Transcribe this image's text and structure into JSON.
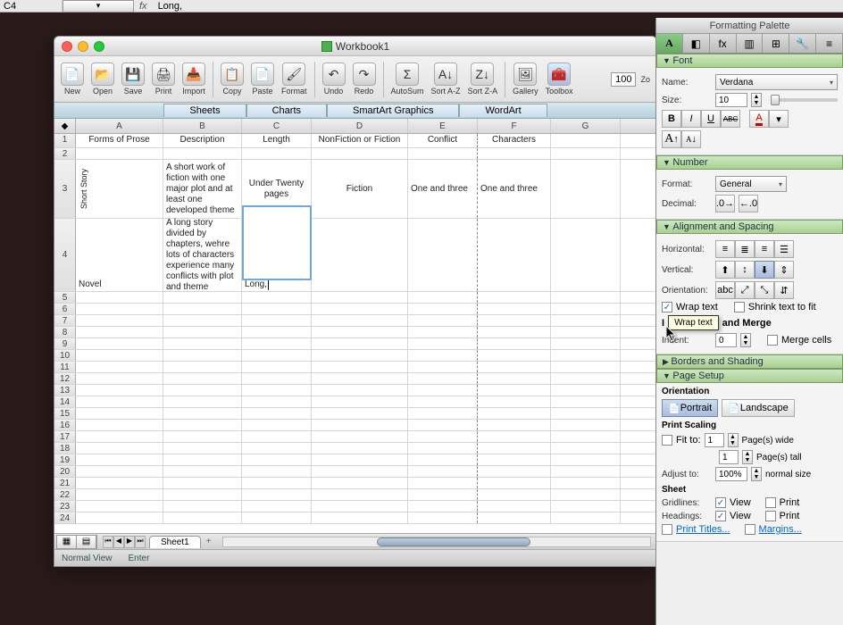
{
  "formula_bar": {
    "cell_ref": "C4",
    "fx_label": "fx",
    "value": "Long,"
  },
  "window": {
    "title": "Workbook1"
  },
  "toolbar": {
    "new": "New",
    "open": "Open",
    "save": "Save",
    "print": "Print",
    "import": "Import",
    "copy": "Copy",
    "paste": "Paste",
    "format": "Format",
    "undo": "Undo",
    "redo": "Redo",
    "autosum": "AutoSum",
    "sortaz": "Sort A-Z",
    "sortza": "Sort Z-A",
    "gallery": "Gallery",
    "toolbox": "Toolbox",
    "zoom": "Zo",
    "zoom_val": "100"
  },
  "viewtabs": {
    "sheets": "Sheets",
    "charts": "Charts",
    "smartart": "SmartArt Graphics",
    "wordart": "WordArt"
  },
  "columns": [
    "A",
    "B",
    "C",
    "D",
    "E",
    "F",
    "G"
  ],
  "headers_row": {
    "forms": "Forms of Prose",
    "desc": "Description",
    "length": "Length",
    "nf": "NonFiction or Fiction",
    "conflict": "Conflict",
    "chars": "Characters"
  },
  "rows": {
    "r3": {
      "a": "Short Story",
      "b": "A short work of fiction with one major plot and at least one developed theme",
      "c": "Under Twenty pages",
      "d": "Fiction",
      "e": "One and three",
      "f": "One and three"
    },
    "r4": {
      "a": "Novel",
      "b": "A long story divided by chapters, wehre lots of characters experience many conflicts with plot and theme",
      "c": "Long, "
    }
  },
  "row_numbers": [
    "1",
    "2",
    "3",
    "4",
    "5",
    "6",
    "7",
    "8",
    "9",
    "10",
    "11",
    "12",
    "13",
    "14",
    "15",
    "16",
    "17",
    "18",
    "19",
    "20",
    "21",
    "22",
    "23",
    "24"
  ],
  "bottom": {
    "sheet_tab": "Sheet1",
    "add": "+"
  },
  "status": {
    "view": "Normal View",
    "mode": "Enter"
  },
  "palette": {
    "title": "Formatting Palette",
    "font_hdr": "Font",
    "font": {
      "name_lbl": "Name:",
      "name_val": "Verdana",
      "size_lbl": "Size:",
      "size_val": "10",
      "b": "B",
      "i": "I",
      "u": "U",
      "s": "ABC",
      "aplus": "A",
      "aminus": "A"
    },
    "number_hdr": "Number",
    "number": {
      "format_lbl": "Format:",
      "format_val": "General",
      "dec_lbl": "Decimal:"
    },
    "align_hdr": "Alignment and Spacing",
    "align": {
      "h_lbl": "Horizontal:",
      "v_lbl": "Vertical:",
      "o_lbl": "Orientation:",
      "wrap": "Wrap text",
      "shrink": "Shrink text to fit",
      "indmerge": "and Merge",
      "ind_lbl": "Indent:",
      "ind_val": "0",
      "merge": "Merge cells",
      "tooltip": "Wrap text",
      "abc": "abc"
    },
    "borders_hdr": "Borders and Shading",
    "page_hdr": "Page Setup",
    "page": {
      "orient_lbl": "Orientation",
      "portrait": "Portrait",
      "landscape": "Landscape",
      "scale_lbl": "Print Scaling",
      "fit": "Fit to:",
      "fit_w": "1",
      "fit_h": "1",
      "pw": "Page(s) wide",
      "pt": "Page(s) tall",
      "adjust": "Adjust to:",
      "adjust_val": "100%",
      "normal": "normal size",
      "sheet_lbl": "Sheet",
      "grid": "Gridlines:",
      "head": "Headings:",
      "view": "View",
      "print": "Print",
      "titles": "Print Titles...",
      "margins": "Margins..."
    }
  }
}
